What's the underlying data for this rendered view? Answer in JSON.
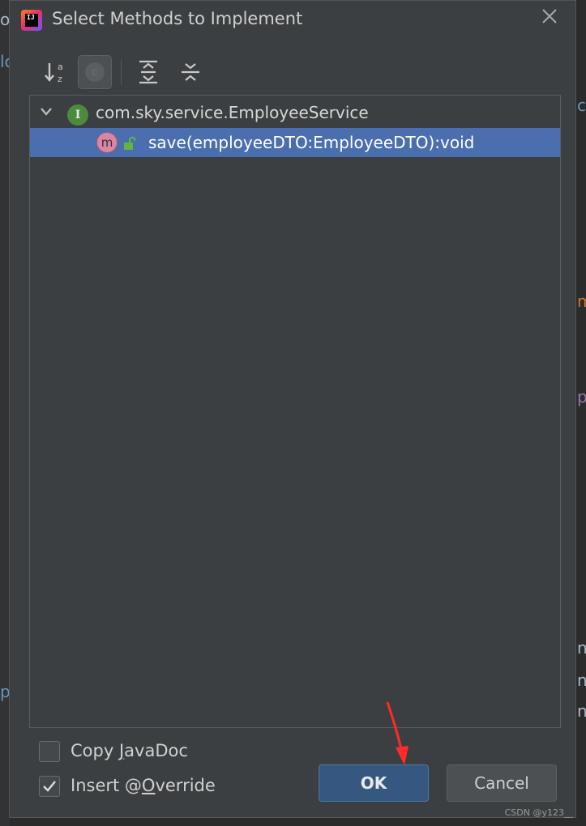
{
  "dialog": {
    "title": "Select Methods to Implement",
    "app_icon_text": "IJ"
  },
  "toolbar": {
    "sort_label": "sort-alphabetically-icon",
    "c_label": "c"
  },
  "tree": {
    "interface": {
      "icon_letter": "I",
      "name": "com.sky.service.EmployeeService"
    },
    "methods": [
      {
        "icon_letter": "m",
        "signature": "save(employeeDTO:EmployeeDTO):void",
        "selected": true
      }
    ]
  },
  "options": {
    "copy_javadoc_pre": "Copy ",
    "copy_javadoc_mn": "J",
    "copy_javadoc_post": "avaDoc",
    "copy_javadoc_checked": false,
    "insert_override_pre": "Insert @",
    "insert_override_mn": "O",
    "insert_override_post": "verride",
    "insert_override_checked": true
  },
  "buttons": {
    "ok": "OK",
    "cancel": "Cancel"
  },
  "background": {
    "frag1": "o",
    "frag2": "lc",
    "frag3": "m",
    "frag4": "p",
    "frag5": "p",
    "frag6": "n",
    "frag7": "n",
    "frag8": "n",
    "frag9": "c"
  },
  "watermark": "CSDN @y123__",
  "colors": {
    "dialog_bg": "#3c3f41",
    "selection": "#4b6eaf",
    "ok_button": "#365880",
    "interface_icon": "#4e8a3e",
    "method_icon": "#d986a2",
    "annotation_arrow": "#ff2a2a"
  }
}
